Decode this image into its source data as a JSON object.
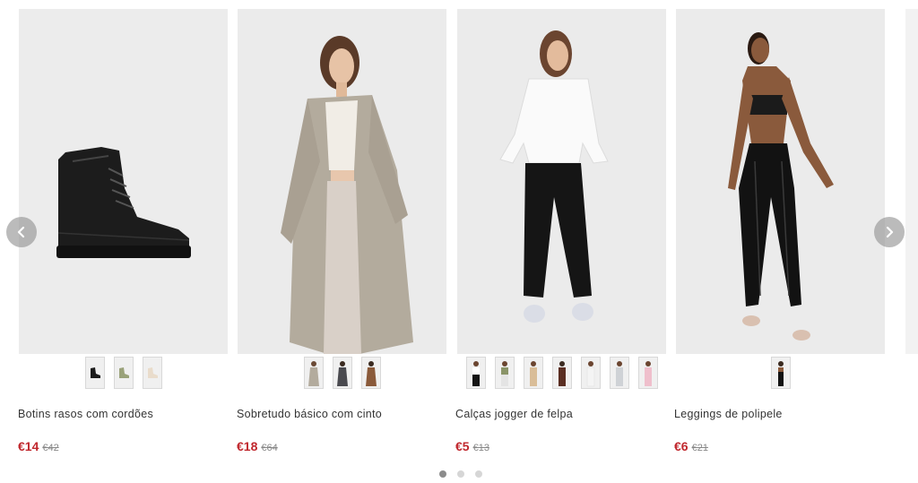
{
  "carousel": {
    "prev_icon": "chevron-left-icon",
    "next_icon": "chevron-right-icon",
    "active_page": 1,
    "page_count": 3
  },
  "products": [
    {
      "name": "Botins rasos com cordões",
      "price": "€14",
      "old_price": "€42",
      "image": "black-lace-up-boot",
      "swatch_count": 3
    },
    {
      "name": "Sobretudo básico com cinto",
      "price": "€18",
      "old_price": "€64",
      "image": "model-grey-belted-coat",
      "swatch_count": 3
    },
    {
      "name": "Calças jogger de felpa",
      "price": "€5",
      "old_price": "€13",
      "image": "model-black-jogger-pants",
      "swatch_count": 7
    },
    {
      "name": "Leggings de polipele",
      "price": "€6",
      "old_price": "€21",
      "image": "model-black-faux-leather-leggings",
      "swatch_count": 1
    }
  ],
  "colors": {
    "price": "#c0272d",
    "old_price": "#888888",
    "image_bg": "#ececec",
    "arrow_bg": "#969696"
  }
}
